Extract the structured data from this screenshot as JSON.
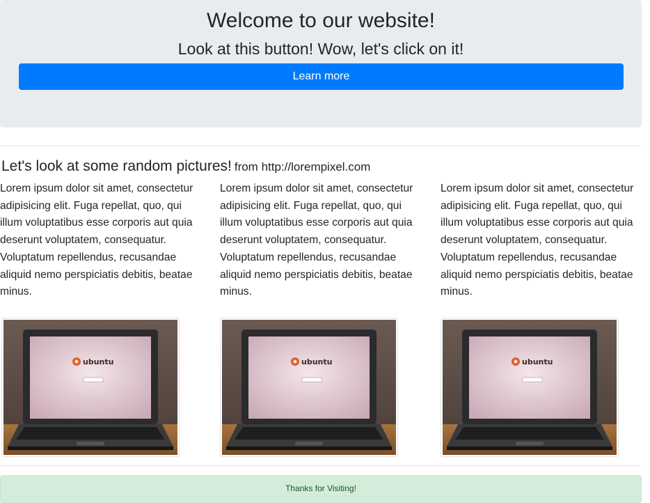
{
  "hero": {
    "title": "Welcome to our website!",
    "subtitle": "Look at this button! Wow, let's click on it!",
    "button_label": "Learn more"
  },
  "gallery": {
    "heading": "Let's look at some random pictures!",
    "heading_small": "from http://lorempixel.com",
    "columns": [
      {
        "text": "Lorem ipsum dolor sit amet, consectetur adipisicing elit. Fuga repellat, quo, qui illum voluptatibus esse corporis aut quia deserunt voluptatem, consequatur. Voluptatum repellendus, recusandae aliquid nemo perspiciatis debitis, beatae minus.",
        "image_alt": "ubuntu"
      },
      {
        "text": "Lorem ipsum dolor sit amet, consectetur adipisicing elit. Fuga repellat, quo, qui illum voluptatibus esse corporis aut quia deserunt voluptatem, consequatur. Voluptatum repellendus, recusandae aliquid nemo perspiciatis debitis, beatae minus.",
        "image_alt": "ubuntu"
      },
      {
        "text": "Lorem ipsum dolor sit amet, consectetur adipisicing elit. Fuga repellat, quo, qui illum voluptatibus esse corporis aut quia deserunt voluptatem, consequatur. Voluptatum repellendus, recusandae aliquid nemo perspiciatis debitis, beatae minus.",
        "image_alt": "ubuntu"
      }
    ]
  },
  "footer": {
    "message": "Thanks for Visiting!"
  },
  "colors": {
    "primary": "#007bff",
    "jumbotron_bg": "#e9ecef",
    "success_bg": "#d4edda",
    "success_text": "#155724"
  }
}
